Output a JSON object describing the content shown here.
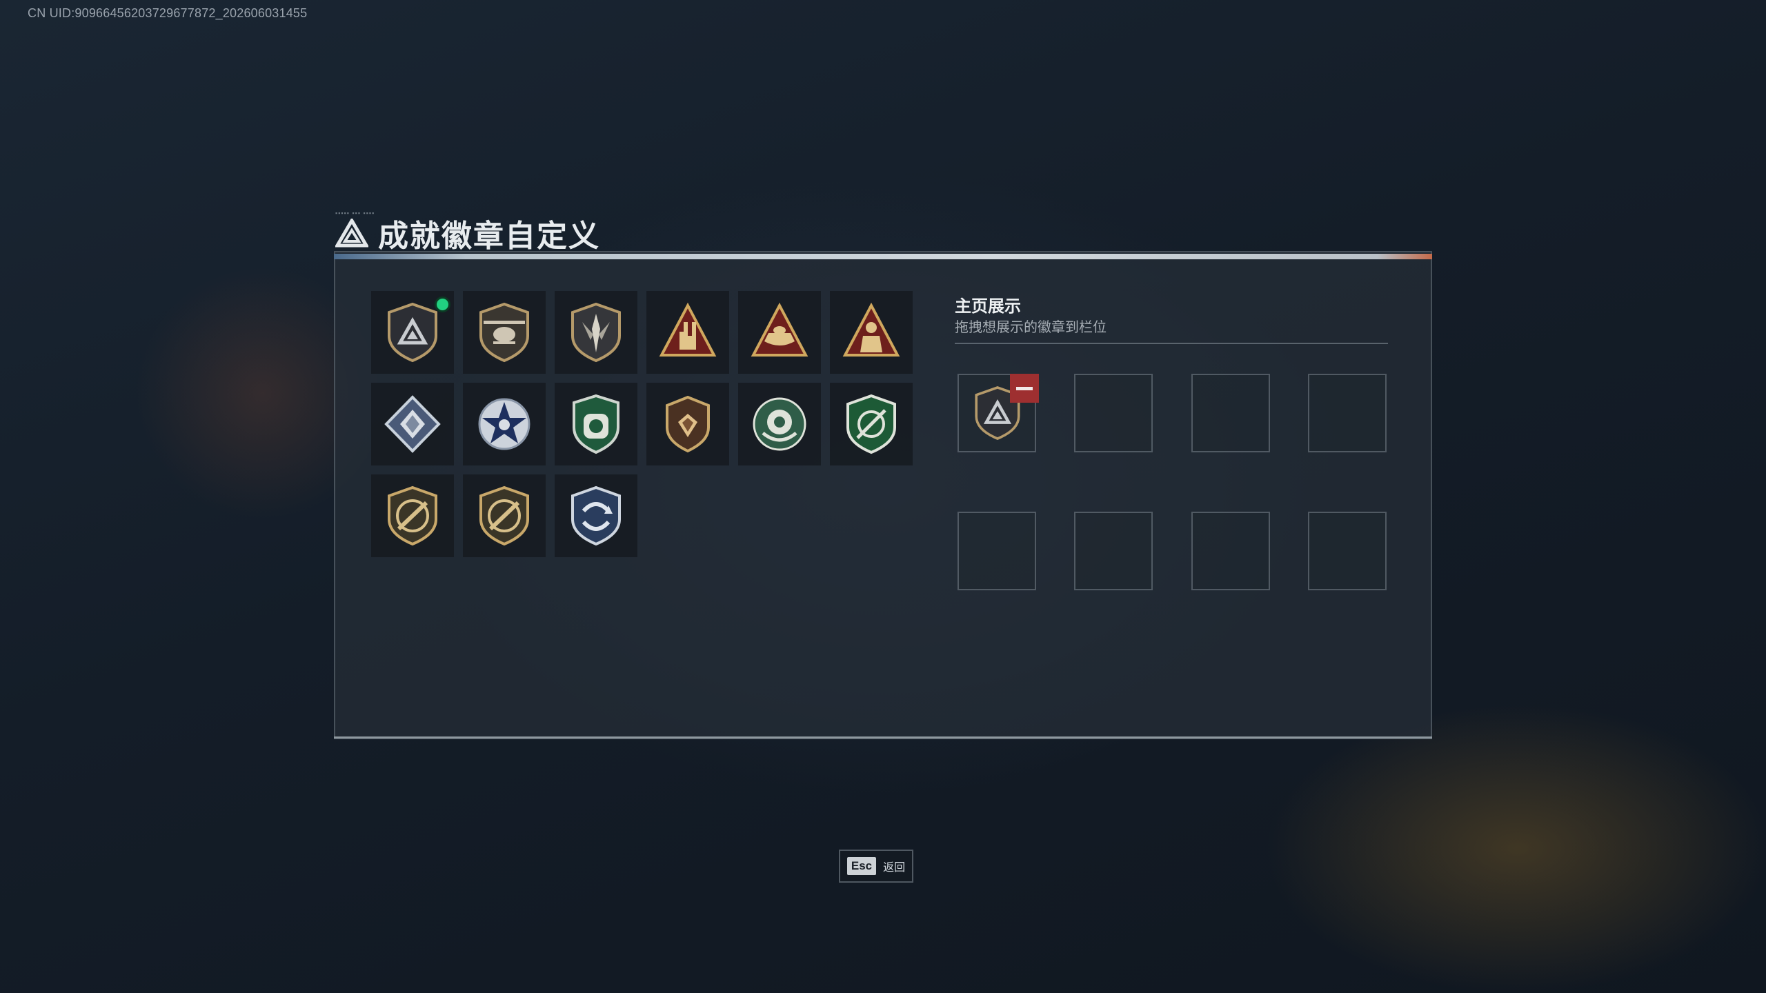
{
  "uid_text": "CN UID:9096645620372967787​2_202606031455",
  "title": "成就徽章自定义",
  "badges": [
    {
      "name": "tri-shield-badge",
      "equipped": true
    },
    {
      "name": "helicopter-badge",
      "equipped": false
    },
    {
      "name": "sword-shield-badge",
      "equipped": false
    },
    {
      "name": "hand-horns-badge",
      "equipped": false
    },
    {
      "name": "boat-badge",
      "equipped": false
    },
    {
      "name": "soldier-badge",
      "equipped": false
    },
    {
      "name": "crystal-diamond-badge",
      "equipped": false
    },
    {
      "name": "star-badge",
      "equipped": false
    },
    {
      "name": "green-shield-badge",
      "equipped": false
    },
    {
      "name": "gem-shield-badge",
      "equipped": false
    },
    {
      "name": "wreath-badge",
      "equipped": false
    },
    {
      "name": "crosshair-shield-badge",
      "equipped": false
    },
    {
      "name": "rifle-badge-1",
      "equipped": false
    },
    {
      "name": "rifle-badge-2",
      "equipped": false
    },
    {
      "name": "arrows-shield-badge",
      "equipped": false
    }
  ],
  "showcase": {
    "title": "主页展示",
    "subtitle": "拖拽想展示的徽章到栏位",
    "slots_filled": 1,
    "slot_count": 8
  },
  "footer": {
    "esc_key": "Esc",
    "esc_label": "返回"
  },
  "colors": {
    "equipped_dot": "#21d080",
    "remove_button": "#9e2f30",
    "gold": "#c9a86a"
  }
}
